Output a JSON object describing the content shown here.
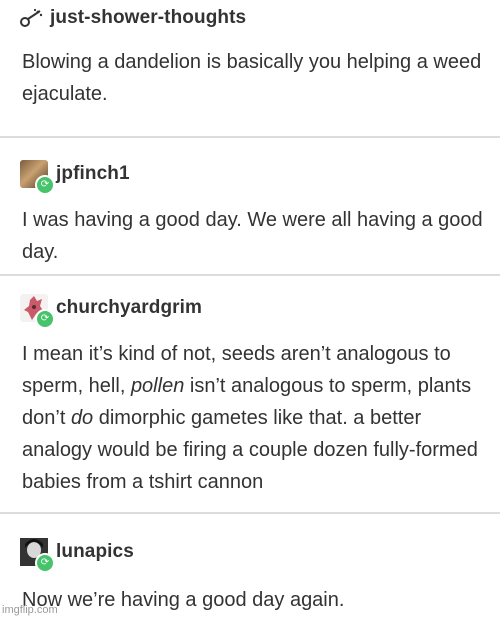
{
  "posts": [
    {
      "username": "just-shower-thoughts",
      "text": "Blowing a dandelion is basically you helping a weed ejaculate."
    },
    {
      "username": "jpfinch1",
      "text": "I was having a good day. We were all having a good day."
    },
    {
      "username": "churchyardgrim",
      "text_parts": [
        "I mean it’s kind of not, seeds aren’t analogous to sperm, hell, ",
        "pollen",
        " isn’t analogous to sperm, plants don’t ",
        "do",
        " dimorphic gametes like that. a better analogy would be firing a couple dozen fully-formed babies from a tshirt cannon"
      ]
    },
    {
      "username": "lunapics",
      "text": "Now we’re having a good day again."
    }
  ],
  "watermark": "imgflip.com",
  "colors": {
    "reblog_badge": "#46c36b",
    "divider": "#dcdcdc",
    "text": "#333333"
  },
  "icons": {
    "post1": "dandelion-logo-icon",
    "reblog": "reblog-icon"
  }
}
